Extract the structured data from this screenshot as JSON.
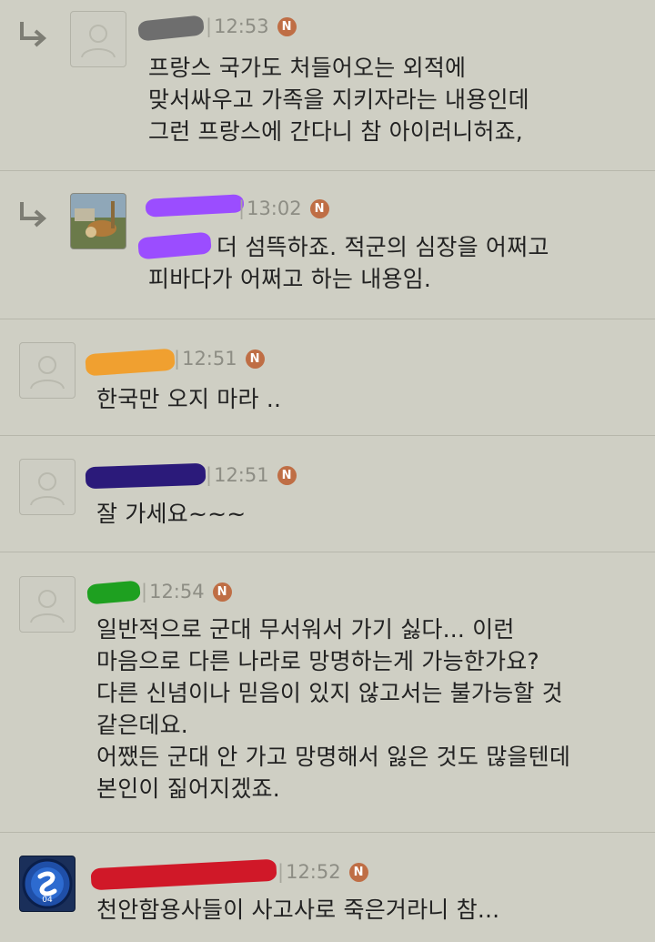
{
  "comments": [
    {
      "is_reply": true,
      "avatar": "default",
      "nickname_redaction_color": "#6e6e6e",
      "time": "12:53",
      "new_badge": "N",
      "text": "프랑스 국가도 처들어오는 외적에\n맞서싸우고 가족을 지키자라는 내용인데\n그런 프랑스에 간다니 참 아이러니허죠,"
    },
    {
      "is_reply": true,
      "avatar": "photo",
      "nickname_redaction_color": "#9b4dff",
      "time": "13:02",
      "new_badge": "N",
      "text": "더 섬뜩하죠. 적군의 심장을 어쩌고\n피바다가 어쩌고 하는 내용임."
    },
    {
      "is_reply": false,
      "avatar": "default",
      "nickname_redaction_color": "#f0a030",
      "time": "12:51",
      "new_badge": "N",
      "text": "한국만 오지 마라 .."
    },
    {
      "is_reply": false,
      "avatar": "default",
      "nickname_redaction_color": "#2b1a7a",
      "time": "12:51",
      "new_badge": "N",
      "text": "잘 가세요~~~"
    },
    {
      "is_reply": false,
      "avatar": "default",
      "nickname_redaction_color": "#1ea020",
      "time": "12:54",
      "new_badge": "N",
      "text": "일반적으로 군대 무서워서 가기 싫다... 이런\n마음으로 다른 나라로 망명하는게 가능한가요?\n다른 신념이나 믿음이 있지 않고서는 불가능할 것\n같은데요.\n어쨌든 군대 안 가고 망명해서 잃은 것도 많을텐데\n본인이 짊어지겠죠."
    },
    {
      "is_reply": false,
      "avatar": "club-logo",
      "nickname_redaction_color": "#d01828",
      "time": "12:52",
      "new_badge": "N",
      "text": "천안함용사들이 사고사로 죽은거라니 참..."
    }
  ]
}
